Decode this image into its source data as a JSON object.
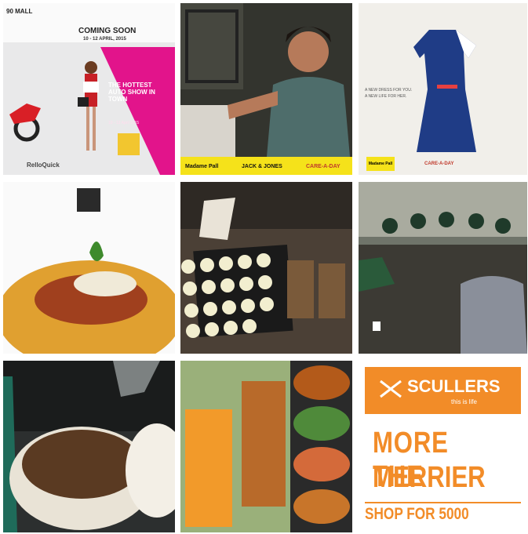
{
  "tiles": [
    {
      "name": "auto-show-promo",
      "header": "90 MALL",
      "coming": "COMING SOON",
      "dates": "10 - 12 APRIL, 2015",
      "headline": "THE HOTTEST AUTO SHOW IN TOWN",
      "sub": "10 - 12 April 2015",
      "brand": "RelloQuick"
    },
    {
      "name": "uniform-girl-photo",
      "logos": [
        "Madame Pall",
        "JACK & JONES",
        "CARE-A-DAY"
      ]
    },
    {
      "name": "dress-promo",
      "lines": [
        "A NEW DRESS FOR YOU.",
        "A NEW LIFE FOR HER."
      ],
      "logos": [
        "Madame Pall",
        "CARE-A-DAY"
      ]
    },
    {
      "name": "spaghetti-photo"
    },
    {
      "name": "cupcakes-photo"
    },
    {
      "name": "group-meeting-photo"
    },
    {
      "name": "coffee-pour-photo"
    },
    {
      "name": "drinks-and-food-photo"
    },
    {
      "name": "scullers-promo",
      "brand": "SCULLERS",
      "tagline": "this is life",
      "line1": "MORE THE",
      "line2": "MERRIER",
      "line3": "SHOP FOR 5000"
    }
  ],
  "colors": {
    "pink": "#e2148b",
    "yellow": "#f5e21a",
    "orange": "#f28c28"
  }
}
